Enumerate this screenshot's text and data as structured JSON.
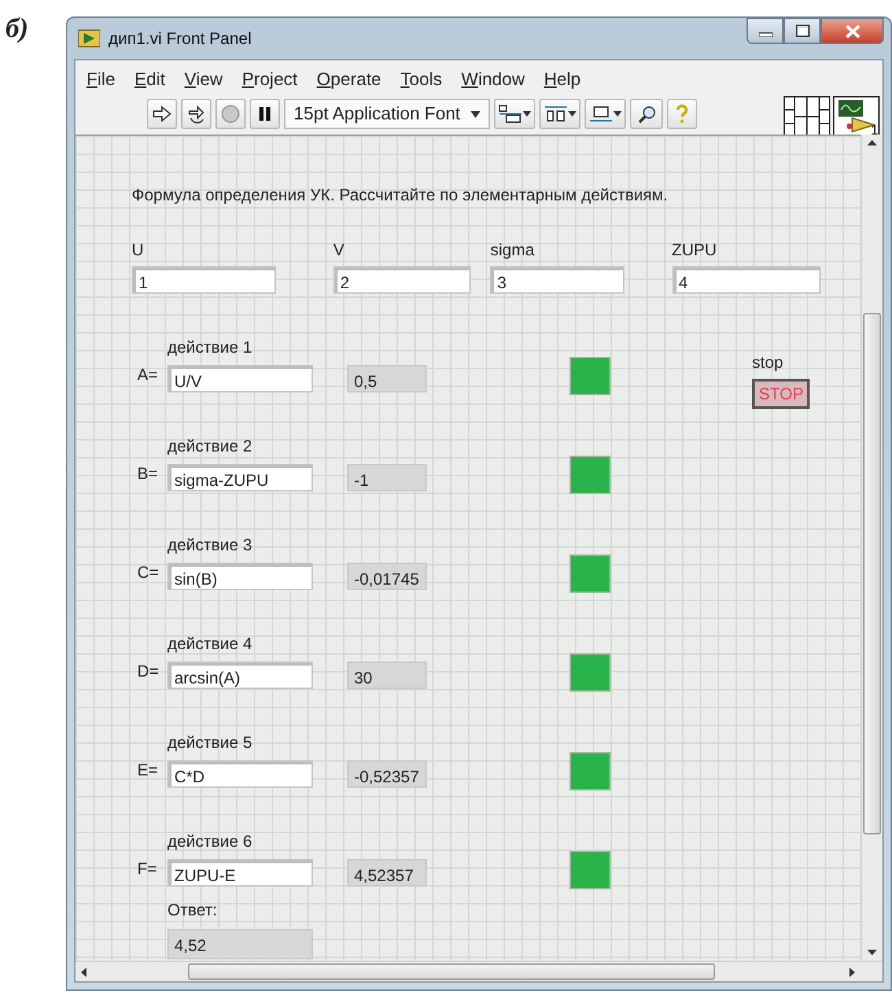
{
  "figure_label": "б)",
  "window": {
    "title": "дип1.vi Front Panel"
  },
  "menu": [
    "File",
    "Edit",
    "View",
    "Project",
    "Operate",
    "Tools",
    "Window",
    "Help"
  ],
  "toolbar": {
    "font": "15pt Application Font",
    "connector_number": "1"
  },
  "panel": {
    "description": "Формула определения УК. Рассчитайте по элементарным действиям.",
    "inputs": [
      {
        "label": "U",
        "value": "1"
      },
      {
        "label": "V",
        "value": "2"
      },
      {
        "label": "sigma",
        "value": "3"
      },
      {
        "label": "ZUPU",
        "value": "4"
      }
    ],
    "actions": [
      {
        "caption": "действие 1",
        "prefix": "A=",
        "formula": "U/V",
        "result": "0,5",
        "led_on": true
      },
      {
        "caption": "действие 2",
        "prefix": "B=",
        "formula": "sigma-ZUPU",
        "result": "-1",
        "led_on": true
      },
      {
        "caption": "действие 3",
        "prefix": "C=",
        "formula": "sin(B)",
        "result": "-0,01745",
        "led_on": true
      },
      {
        "caption": "действие 4",
        "prefix": "D=",
        "formula": "arcsin(A)",
        "result": "30",
        "led_on": true
      },
      {
        "caption": "действие 5",
        "prefix": "E=",
        "formula": "C*D",
        "result": "-0,52357",
        "led_on": true
      },
      {
        "caption": "действие 6",
        "prefix": "F=",
        "formula": "ZUPU-E",
        "result": "4,52357",
        "led_on": true
      }
    ],
    "stop": {
      "label": "stop",
      "button": "STOP"
    },
    "answer": {
      "label": "Ответ:",
      "value": "4,52"
    }
  }
}
